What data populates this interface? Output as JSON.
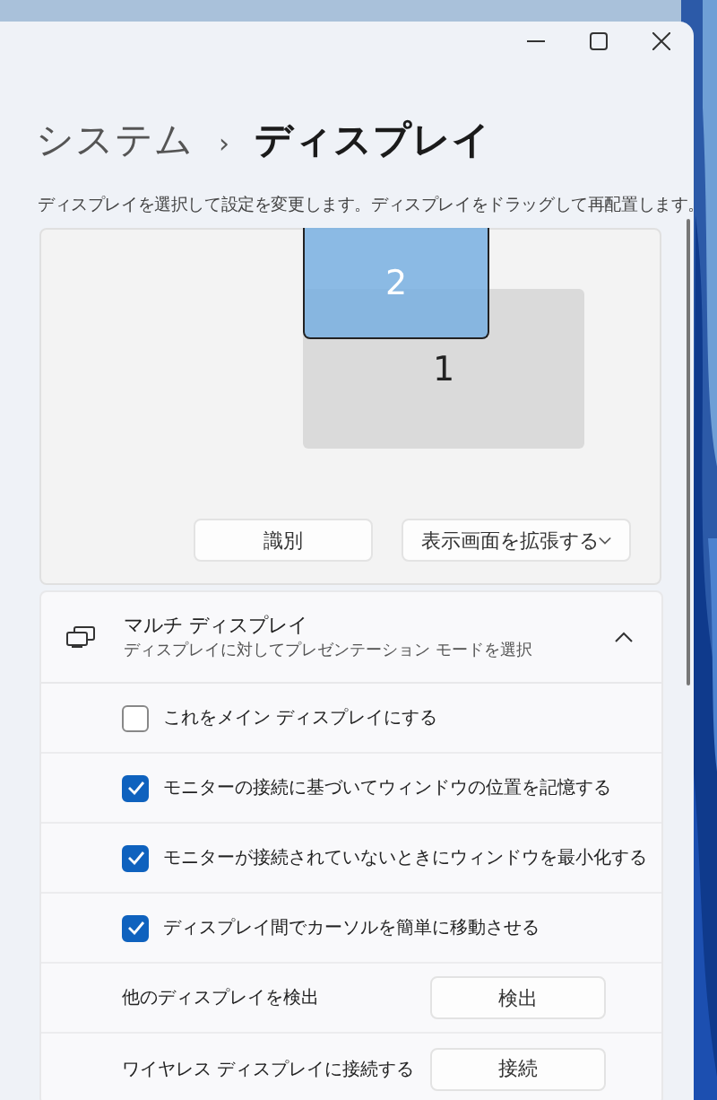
{
  "breadcrumb": {
    "parent": "システム",
    "separator": "›",
    "current": "ディスプレイ"
  },
  "description": "ディスプレイを選択して設定を変更します。ディスプレイをドラッグして再配置します。",
  "monitors": [
    {
      "label": "1",
      "selected": false
    },
    {
      "label": "2",
      "selected": true
    }
  ],
  "identify_button": "識別",
  "mode_dropdown": {
    "value": "表示画面を拡張する"
  },
  "multi_display": {
    "title": "マルチ ディスプレイ",
    "subtitle": "ディスプレイに対してプレゼンテーション モードを選択",
    "expanded": true,
    "rows": [
      {
        "kind": "checkbox",
        "label": "これをメイン ディスプレイにする",
        "checked": false
      },
      {
        "kind": "checkbox",
        "label": "モニターの接続に基づいてウィンドウの位置を記憶する",
        "checked": true
      },
      {
        "kind": "checkbox",
        "label": "モニターが接続されていないときにウィンドウを最小化する",
        "checked": true
      },
      {
        "kind": "checkbox",
        "label": "ディスプレイ間でカーソルを簡単に移動させる",
        "checked": true
      },
      {
        "kind": "button",
        "label": "他のディスプレイを検出",
        "button": "検出"
      },
      {
        "kind": "button",
        "label": "ワイヤレス ディスプレイに接続する",
        "button": "接続"
      }
    ]
  }
}
